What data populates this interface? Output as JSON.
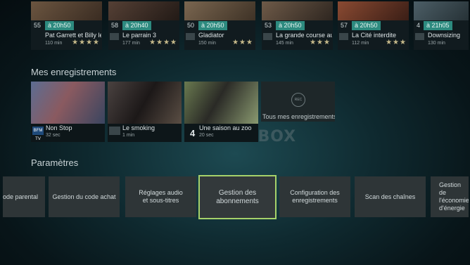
{
  "brand_logo": "SFR BOX",
  "movies": [
    {
      "channel": "55",
      "time": "à 20h50",
      "title": "Pat Garrett et Billy le",
      "duration": "110 min",
      "stars": "★★★★",
      "channel_logo": "",
      "thumb": "#4a3a2c"
    },
    {
      "channel": "58",
      "time": "à 20h40",
      "title": "Le parrain 3",
      "duration": "177 min",
      "stars": "★★★★",
      "channel_logo": "",
      "thumb": "#3a2f2a"
    },
    {
      "channel": "50",
      "time": "à 20h50",
      "title": "Gladiator",
      "duration": "150 min",
      "stars": "★★★",
      "channel_logo": "",
      "thumb": "#5a4a3a"
    },
    {
      "channel": "53",
      "time": "à 20h50",
      "title": "La grande course au",
      "duration": "145 min",
      "stars": "★★★",
      "channel_logo": "",
      "thumb": "#4c4036"
    },
    {
      "channel": "57",
      "time": "à 20h50",
      "title": "La Cité interdite",
      "duration": "112 min",
      "stars": "★★★",
      "channel_logo": "",
      "thumb": "#6a3a2a"
    },
    {
      "channel": "4",
      "time": "à 21h05",
      "title": "Downsizing",
      "duration": "130 min",
      "stars": "",
      "channel_logo": "",
      "thumb": "#3c4a52"
    }
  ],
  "recordings_title": "Mes enregistrements",
  "recordings": [
    {
      "title": "Non Stop",
      "sub": "32 sec",
      "logo": "BFM TV",
      "thumb": "#4a5a7a"
    },
    {
      "title": "Le smoking",
      "sub": "1 min",
      "logo": "",
      "thumb": "#2e2a28"
    },
    {
      "title": "Une saison au zoo",
      "sub": "20 sec",
      "logo": "",
      "num": "4",
      "thumb": "#4a5a3a"
    }
  ],
  "all_recordings_label": "Tous mes enregistrements",
  "settings_title": "Paramètres",
  "settings": [
    "Code parental",
    "Gestion du code achat",
    "Réglages audio et sous-titres",
    "Gestion des abonnements",
    "Configuration des enregistrements",
    "Scan des chaînes",
    "Gestion de l'économie d'énergie"
  ],
  "colors": {
    "focus": "#a6d26a",
    "time_pill": "#2d8a7f"
  }
}
